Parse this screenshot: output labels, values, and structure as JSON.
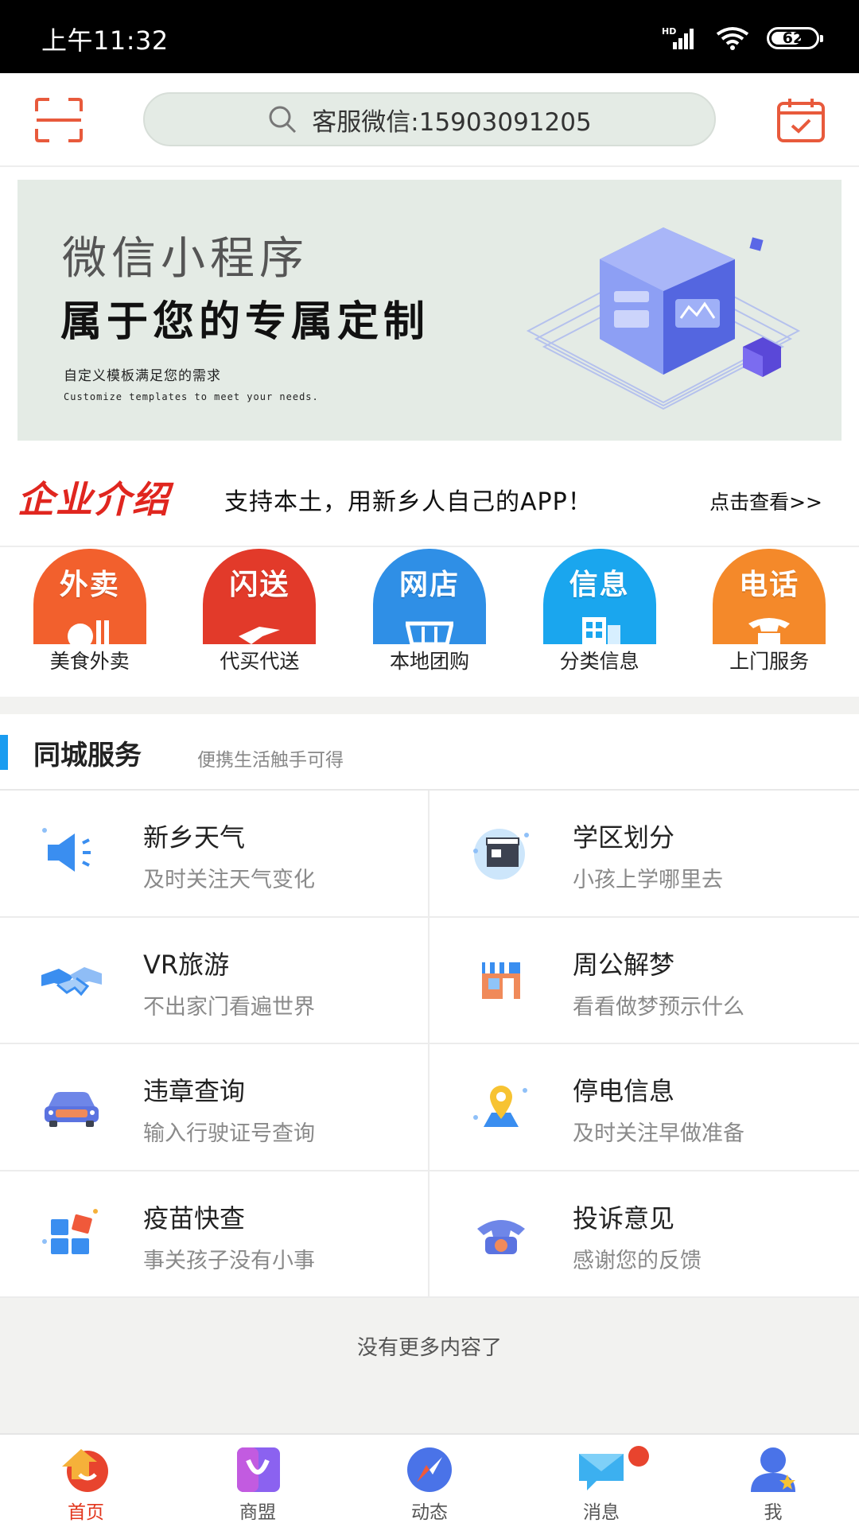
{
  "status_bar": {
    "time": "上午11:32",
    "network": "HD",
    "battery": "62"
  },
  "header": {
    "search_text": "客服微信:15903091205"
  },
  "banner": {
    "title": "微信小程序",
    "headline": "属于您的专属定制",
    "caption": "自定义模板满足您的需求",
    "caption_en": "Customize templates to meet your needs."
  },
  "intro": {
    "logo": "企业介绍",
    "message": "支持本土，用新乡人自己的APP！",
    "more": "点击查看>>"
  },
  "quick_nav": [
    {
      "icon_label": "外卖",
      "name": "美食外卖",
      "color": "#f2602d",
      "icon": "takeout-icon"
    },
    {
      "icon_label": "闪送",
      "name": "代买代送",
      "color": "#e23a2a",
      "icon": "delivery-icon"
    },
    {
      "icon_label": "网店",
      "name": "本地团购",
      "color": "#2f8fe6",
      "icon": "shop-icon"
    },
    {
      "icon_label": "信息",
      "name": "分类信息",
      "color": "#1aa6ee",
      "icon": "info-icon"
    },
    {
      "icon_label": "电话",
      "name": "上门服务",
      "color": "#f4892a",
      "icon": "phone-icon"
    }
  ],
  "section": {
    "title": "同城服务",
    "subtitle": "便携生活触手可得"
  },
  "services": [
    {
      "title": "新乡天气",
      "subtitle": "及时关注天气变化",
      "icon": "speaker-icon"
    },
    {
      "title": "学区划分",
      "subtitle": "小孩上学哪里去",
      "icon": "clapper-icon"
    },
    {
      "title": "VR旅游",
      "subtitle": "不出家门看遍世界",
      "icon": "handshake-icon"
    },
    {
      "title": "周公解梦",
      "subtitle": "看看做梦预示什么",
      "icon": "storefront-icon"
    },
    {
      "title": "违章查询",
      "subtitle": "输入行驶证号查询",
      "icon": "car-icon"
    },
    {
      "title": "停电信息",
      "subtitle": "及时关注早做准备",
      "icon": "location-pin-icon"
    },
    {
      "title": "疫苗快查",
      "subtitle": "事关孩子没有小事",
      "icon": "blocks-icon"
    },
    {
      "title": "投诉意见",
      "subtitle": "感谢您的反馈",
      "icon": "telephone-icon"
    }
  ],
  "footer_note": "没有更多内容了",
  "tabs": [
    {
      "label": "首页",
      "icon": "home-icon",
      "active": true
    },
    {
      "label": "商盟",
      "icon": "bag-icon",
      "active": false
    },
    {
      "label": "动态",
      "icon": "compass-icon",
      "active": false
    },
    {
      "label": "消息",
      "icon": "message-icon",
      "active": false
    },
    {
      "label": "我",
      "icon": "profile-icon",
      "active": false
    }
  ],
  "colors": {
    "accent": "#e2361d",
    "section_bar": "#1a9cf0",
    "banner_bg": "#e4ebe5"
  }
}
